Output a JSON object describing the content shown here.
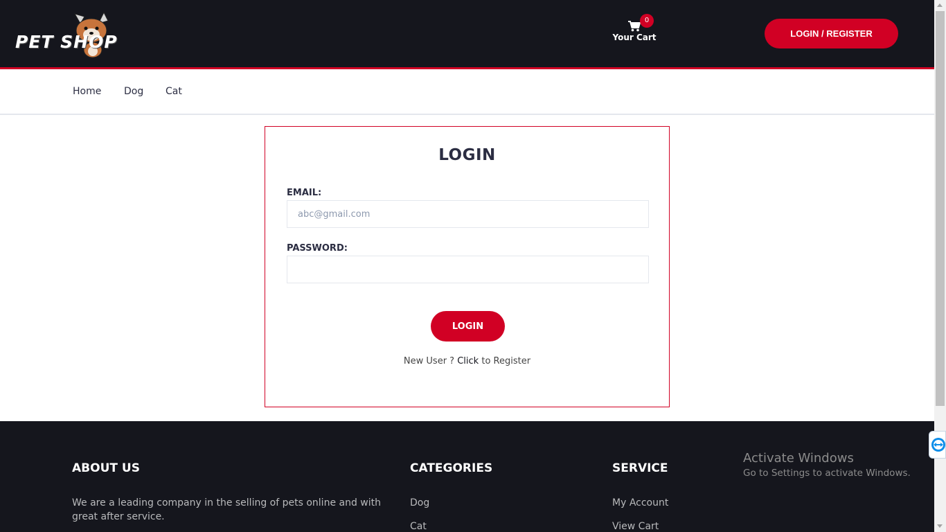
{
  "header": {
    "logo_text": "PET SHOP",
    "cart_label": "Your Cart",
    "cart_count": "0",
    "login_register_label": "LOGIN / REGISTER"
  },
  "nav": {
    "items": [
      {
        "label": "Home"
      },
      {
        "label": "Dog"
      },
      {
        "label": "Cat"
      }
    ]
  },
  "login": {
    "title": "LOGIN",
    "email_label": "EMAIL:",
    "email_placeholder": "abc@gmail.com",
    "email_value": "",
    "password_label": "PASSWORD:",
    "password_value": "",
    "button_label": "LOGIN",
    "register_prefix": "New User ?",
    "register_link": "Click",
    "register_suffix": "to Register"
  },
  "footer": {
    "about_heading": "ABOUT US",
    "about_text": "We are a leading company in the selling of pets online and with great after service.",
    "categories_heading": "CATEGORIES",
    "categories": [
      "Dog",
      "Cat"
    ],
    "service_heading": "SERVICE",
    "service_links": [
      "My Account",
      "View Cart"
    ]
  },
  "watermark": {
    "title": "Activate Windows",
    "subtitle": "Go to Settings to activate Windows."
  },
  "colors": {
    "accent": "#d10024",
    "dark": "#15161d",
    "nav_text": "#2b2d42"
  }
}
